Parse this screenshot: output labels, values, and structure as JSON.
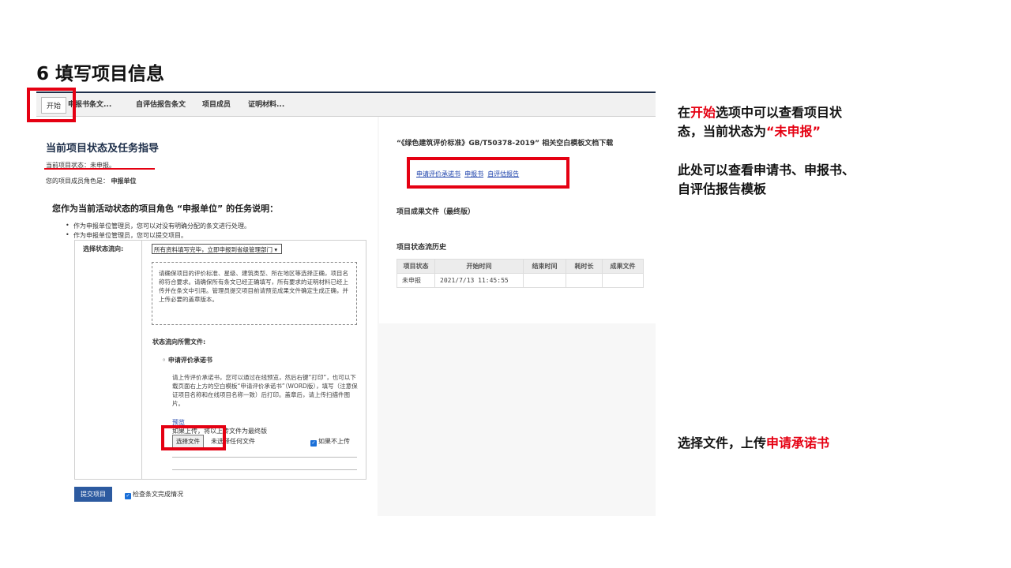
{
  "slide": {
    "title": "6 填写项目信息",
    "notes": {
      "note1_a": "在",
      "note1_b": "开始",
      "note1_c": "选项中可以查看项目状",
      "note1_d": "态，当前状态为",
      "note1_e": "“未申报”",
      "note2_line1": "此处可以查看申请书、申报书、",
      "note2_line2": "自评估报告模板",
      "note3_a": "选择文件，上传",
      "note3_b": "申请承诺书"
    }
  },
  "tabs": [
    "开始",
    "申报书条文...",
    "自评估报告条文",
    "项目成员",
    "证明材料..."
  ],
  "left": {
    "heading": "当前项目状态及任务指导",
    "status": "当前项目状态：未申报。",
    "role_prefix": "您的项目成员角色是：",
    "role": "申报单位",
    "task_heading": "您作为当前活动状态的项目角色 “申报单位” 的任务说明：",
    "bullet1": "作为申报单位管理员，您可以对没有明确分配的条文进行处理。",
    "bullet2": "作为申报单位管理员，您可以提交项目。",
    "flow_label": "选择状态流向:",
    "flow_selected": "所有资料填写完毕，立即申报到省级管理部门 ▾",
    "instructions": "请确保项目的评价标准、星级、建筑类型、所在地区等选择正确，项目名称符合要求。请确保所有条文已经正确填写，所有要求的证明材料已经上传并在条文中引用。管理员提交项目前请预览成果文件确定生成正确，并上传必要的盖章版本。",
    "files_label": "状态流向所需文件:",
    "file_item": "申请评价承诺书",
    "file_desc": "请上传评价承诺书，您可以通过在线预览，然后右键“打印”，也可以下载页面右上方的空白模板“申请评价承诺书”（WORD版），填写（注意保证项目名称和在线项目名称一致）后打印。盖章后，请上传扫描件图片。",
    "preview_link": "预览",
    "final_note": "如果上传，将以上传文件为最终版",
    "choose_file": "选择文件",
    "no_file": "未选择任何文件",
    "no_upload": "如果不上传",
    "submit": "提交项目",
    "check_label": "检查条文完成情况"
  },
  "right": {
    "templates_heading": "“《绿色建筑评价标准》GB/T50378-2019” 相关空白模板文档下载",
    "links": [
      "申请评价承诺书",
      "申报书",
      "自评估报告"
    ],
    "result_heading": "项目成果文件（最终版）",
    "history_heading": "项目状态流历史",
    "table": {
      "headers": [
        "项目状态",
        "开始时间",
        "结束时间",
        "耗时长",
        "成果文件"
      ],
      "rows": [
        [
          "未申报",
          "2021/7/13 11:45:55",
          "",
          "",
          ""
        ]
      ]
    }
  },
  "colors": {
    "accent_red": "#e50012",
    "nav_dark": "#1e2f4a",
    "button_blue": "#2c5aa0"
  }
}
